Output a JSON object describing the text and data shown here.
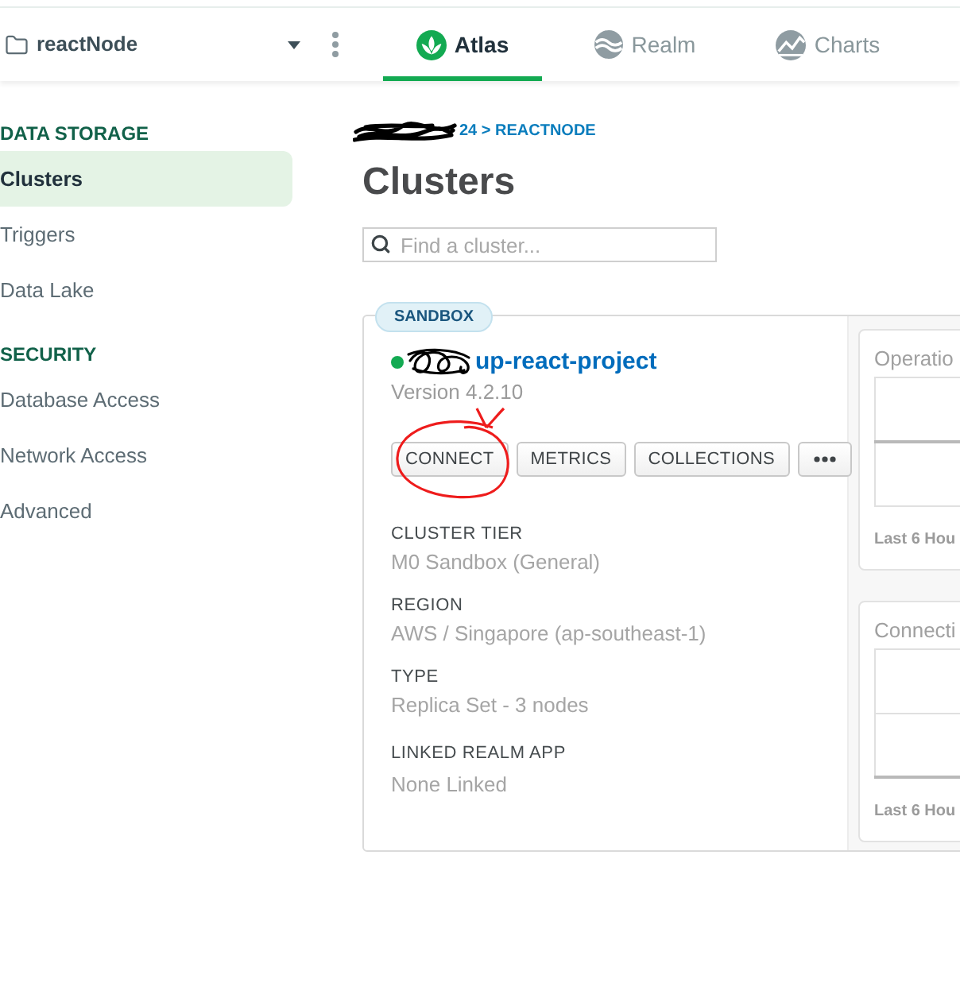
{
  "top_nav": {
    "project": "reactNode",
    "tabs": [
      {
        "label": "Atlas",
        "selected": true
      },
      {
        "label": "Realm",
        "selected": false
      },
      {
        "label": "Charts",
        "selected": false
      }
    ]
  },
  "sidebar": {
    "sections": [
      {
        "heading": "DATA STORAGE",
        "items": [
          {
            "label": "Clusters",
            "selected": true
          },
          {
            "label": "Triggers",
            "selected": false
          },
          {
            "label": "Data Lake",
            "selected": false
          }
        ]
      },
      {
        "heading": "SECURITY",
        "items": [
          {
            "label": "Database Access",
            "selected": false
          },
          {
            "label": "Network Access",
            "selected": false
          },
          {
            "label": "Advanced",
            "selected": false
          }
        ]
      }
    ]
  },
  "main": {
    "breadcrumb": "24 > REACTNODE",
    "title": "Clusters",
    "search": {
      "placeholder": "Find a cluster..."
    },
    "cluster": {
      "badge": "SANDBOX",
      "name": "up-react-project",
      "version": "Version 4.2.10",
      "buttons": [
        "CONNECT",
        "METRICS",
        "COLLECTIONS"
      ],
      "details": [
        {
          "label": "CLUSTER TIER",
          "value": "M0 Sandbox (General)"
        },
        {
          "label": "REGION",
          "value": "AWS / Singapore (ap-southeast-1)"
        },
        {
          "label": "TYPE",
          "value": "Replica Set - 3 nodes"
        },
        {
          "label": "LINKED REALM APP",
          "value": "None Linked"
        }
      ],
      "metrics": [
        {
          "title": "Operatio",
          "footer": "Last 6 Hou"
        },
        {
          "title": "Connecti",
          "footer": "Last 6 Hou"
        }
      ]
    }
  }
}
